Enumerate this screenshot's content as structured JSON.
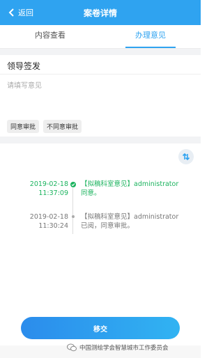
{
  "header": {
    "back_label": "返回",
    "title": "案卷详情"
  },
  "tabs": [
    {
      "label": "内容查看",
      "active": false
    },
    {
      "label": "办理意见",
      "active": true
    }
  ],
  "form": {
    "section_label": "领导签发",
    "opinion_placeholder": "请填写意见",
    "quick_phrases": [
      "同意审批",
      "不同意审批"
    ]
  },
  "timeline": [
    {
      "date": "2019-02-18",
      "time": "11:37:09",
      "title": "【拟稿科室意见】administrator",
      "comment": "同意。",
      "status_color": "#1bb35e",
      "completed": true
    },
    {
      "date": "2019-02-18",
      "time": "11:30:24",
      "title": "【拟稿科室意见】administrator",
      "comment": "已阅，同意审批。",
      "status_color": "#999999",
      "completed": false
    }
  ],
  "submit_label": "移交",
  "watermark": "中国测绘学会智慧城市工作委员会",
  "colors": {
    "accent": "#2fa3f0",
    "success": "#1bb35e"
  }
}
